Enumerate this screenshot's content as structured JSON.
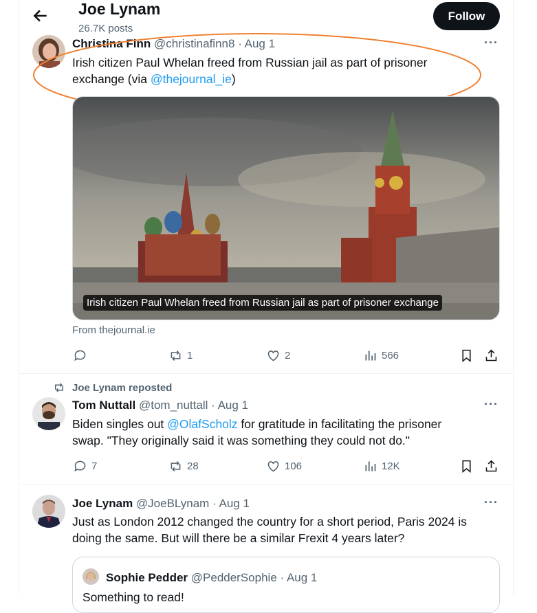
{
  "header": {
    "title": "Joe Lynam",
    "subtitle": "26.7K posts",
    "follow_label": "Follow"
  },
  "tweets": [
    {
      "name": "Christina Finn",
      "handle": "@christinafinn8",
      "date": "· Aug 1",
      "text_1": "Irish citizen Paul Whelan freed from Russian jail as part of prisoner",
      "text_2a": "exchange (via ",
      "text_2_link": "@thejournal_ie",
      "text_2b": ")",
      "card_caption": "Irish citizen Paul Whelan freed from Russian jail as part of prisoner exchange",
      "card_source": "From thejournal.ie",
      "reposts": "1",
      "likes": "2",
      "views": "566"
    },
    {
      "reposted_by": "Joe Lynam reposted",
      "name": "Tom Nuttall",
      "handle": "@tom_nuttall",
      "date": "· Aug 1",
      "text_1a": "Biden singles out ",
      "text_1_link": "@OlafScholz",
      "text_1b": " for gratitude in facilitating the prisoner",
      "text_2": "swap. \"They originally said it was something they could not do.\"",
      "replies": "7",
      "reposts": "28",
      "likes": "106",
      "views": "12K"
    },
    {
      "name": "Joe Lynam",
      "handle": "@JoeBLynam",
      "date": "· Aug 1",
      "text_1": "Just as London 2012 changed the country for a short period, Paris 2024 is",
      "text_2": "doing the same.  But will there be a similar Frexit 4 years later?",
      "quote": {
        "name": "Sophie Pedder",
        "handle": "@PedderSophie",
        "date": "· Aug 1",
        "text": "Something to read!"
      }
    }
  ],
  "colors": {
    "accent": "#1d9bf0",
    "annotation": "#f08030",
    "text": "#0f1419",
    "muted": "#536471"
  },
  "icons": [
    "back-arrow-icon",
    "more-icon",
    "reply-icon",
    "repost-icon",
    "like-icon",
    "views-icon",
    "bookmark-icon",
    "share-icon"
  ]
}
